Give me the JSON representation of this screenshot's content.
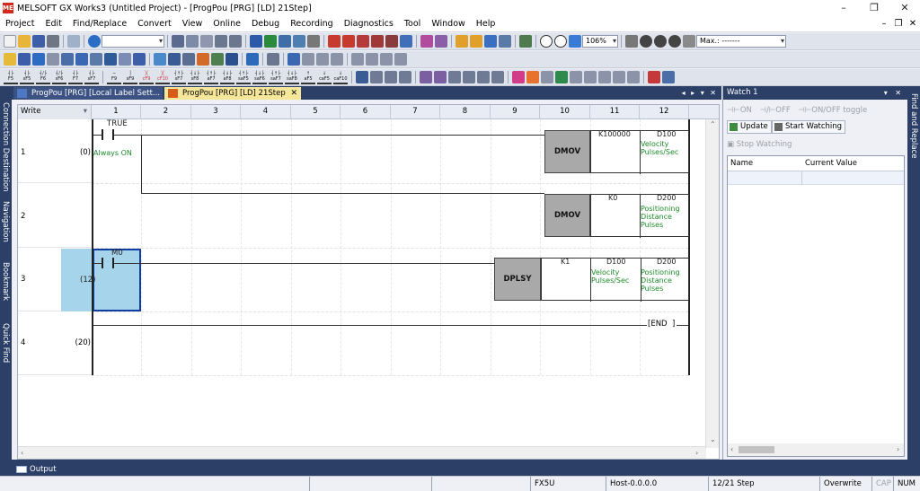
{
  "window": {
    "title": "MELSOFT GX Works3 (Untitled Project) - [ProgPou [PRG] [LD] 21Step]",
    "app_icon": "MEL",
    "min_symbol": "–",
    "max_symbol": "❐",
    "close_symbol": "✕"
  },
  "menu": {
    "items": [
      "Project",
      "Edit",
      "Find/Replace",
      "Convert",
      "View",
      "Online",
      "Debug",
      "Recording",
      "Diagnostics",
      "Tool",
      "Window",
      "Help"
    ],
    "mdi_controls": [
      "–",
      "❐",
      "✕"
    ]
  },
  "toolbar": {
    "zoom_value": "106%",
    "max_combo": "Max.: -------",
    "fkeys": [
      {
        "sym": "┤├",
        "key": "F5"
      },
      {
        "sym": "┤├",
        "key": "sF5"
      },
      {
        "sym": "┤/├",
        "key": "F6"
      },
      {
        "sym": "┤/├",
        "key": "sF6"
      },
      {
        "sym": "┤├",
        "key": "F7"
      },
      {
        "sym": "┤├",
        "key": "sF7"
      },
      {
        "sym": "─",
        "key": "F9"
      },
      {
        "sym": "│",
        "key": "sF9"
      },
      {
        "sym": "╳",
        "key": "cF9"
      },
      {
        "sym": "╳",
        "key": "cF10"
      },
      {
        "sym": "┤↑├",
        "key": "sF7"
      },
      {
        "sym": "┤↓├",
        "key": "sF8"
      },
      {
        "sym": "┤↑├",
        "key": "aF7"
      },
      {
        "sym": "┤↓├",
        "key": "aF8"
      },
      {
        "sym": "┤↑├",
        "key": "saF5"
      },
      {
        "sym": "┤↓├",
        "key": "saF6"
      },
      {
        "sym": "┤↑├",
        "key": "saF7"
      },
      {
        "sym": "┤↓├",
        "key": "saF8"
      },
      {
        "sym": "↑",
        "key": "aF5"
      },
      {
        "sym": "↓",
        "key": "caF5"
      },
      {
        "sym": "↓",
        "key": "caF10"
      }
    ]
  },
  "left_drawer": {
    "tabs": [
      "Connection Destination",
      "Navigation",
      "Bookmark",
      "Quick Find"
    ]
  },
  "right_drawer": {
    "label": "Find and Replace"
  },
  "tabs": {
    "tab1": "ProgPou [PRG] [Local Label Sett...",
    "tab2": "ProgPou [PRG] [LD] 21Step",
    "tab2_close": "✕",
    "controls": "◂ ▸ ▾ ✕"
  },
  "editor": {
    "mode": "Write",
    "columns": [
      "1",
      "2",
      "3",
      "4",
      "5",
      "6",
      "7",
      "8",
      "9",
      "10",
      "11",
      "12"
    ],
    "rows": [
      {
        "num": "1",
        "step": "(0)"
      },
      {
        "num": "2",
        "step": ""
      },
      {
        "num": "3",
        "step": "(12)"
      },
      {
        "num": "4",
        "step": "(20)"
      }
    ],
    "rung1": {
      "contact": "TRUE",
      "contact_comment": "Always ON",
      "instr1": "DMOV",
      "instr1_s": "K100000",
      "instr1_d": "D100",
      "instr1_d_comment": "Velocity Pulses/Sec",
      "instr2": "DMOV",
      "instr2_s": "K0",
      "instr2_d": "D200",
      "instr2_d_comment": "Positioning Distance Pulses"
    },
    "rung3": {
      "contact": "M0",
      "instr": "DPLSY",
      "op1": "K1",
      "op2": "D100",
      "op2_comment": "Velocity Pulses/Sec",
      "op3": "D200",
      "op3_comment": "Positioning Distance Pulses"
    },
    "end_label": "END"
  },
  "watch": {
    "title": "Watch 1",
    "controls": "▾ ✕",
    "on_label": "ON",
    "off_label": "OFF",
    "toggle_label": "ON/OFF toggle",
    "update_label": "Update",
    "start_label": "Start Watching",
    "stop_label": "Stop Watching",
    "col_name": "Name",
    "col_value": "Current Value"
  },
  "output": {
    "label": "Output"
  },
  "status": {
    "plc": "FX5U",
    "host": "Host-0.0.0.0",
    "steps": "12/21 Step",
    "mode": "Overwrite",
    "cap": "CAP",
    "num": "NUM"
  },
  "colors": {
    "accent_dark": "#2b3f67",
    "comment_green": "#1c8a2a",
    "selection": "#a6d4ea",
    "active_tab": "#f6e69a"
  }
}
